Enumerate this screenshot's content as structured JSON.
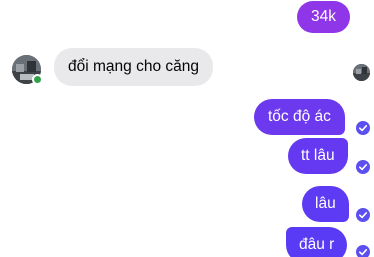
{
  "colors": {
    "outgoing_top": "#9b36e6",
    "outgoing_bottom": "#5b3cf5",
    "incoming_bg": "#e9e9eb",
    "online": "#31a24c",
    "seen_check": "#5c4ff0"
  },
  "messages": [
    {
      "direction": "outgoing",
      "text": "34k"
    },
    {
      "direction": "incoming",
      "text": "đổi mạng cho căng"
    },
    {
      "direction": "outgoing",
      "text": "tốc độ ác"
    },
    {
      "direction": "outgoing",
      "text": "tt lâu"
    },
    {
      "direction": "outgoing",
      "text": "lâu"
    },
    {
      "direction": "outgoing",
      "text": "đâu r"
    }
  ],
  "icons": {
    "sender_avatar": "avatar-image",
    "online_status": "online-dot-icon",
    "delivered": "check-circle-icon"
  }
}
